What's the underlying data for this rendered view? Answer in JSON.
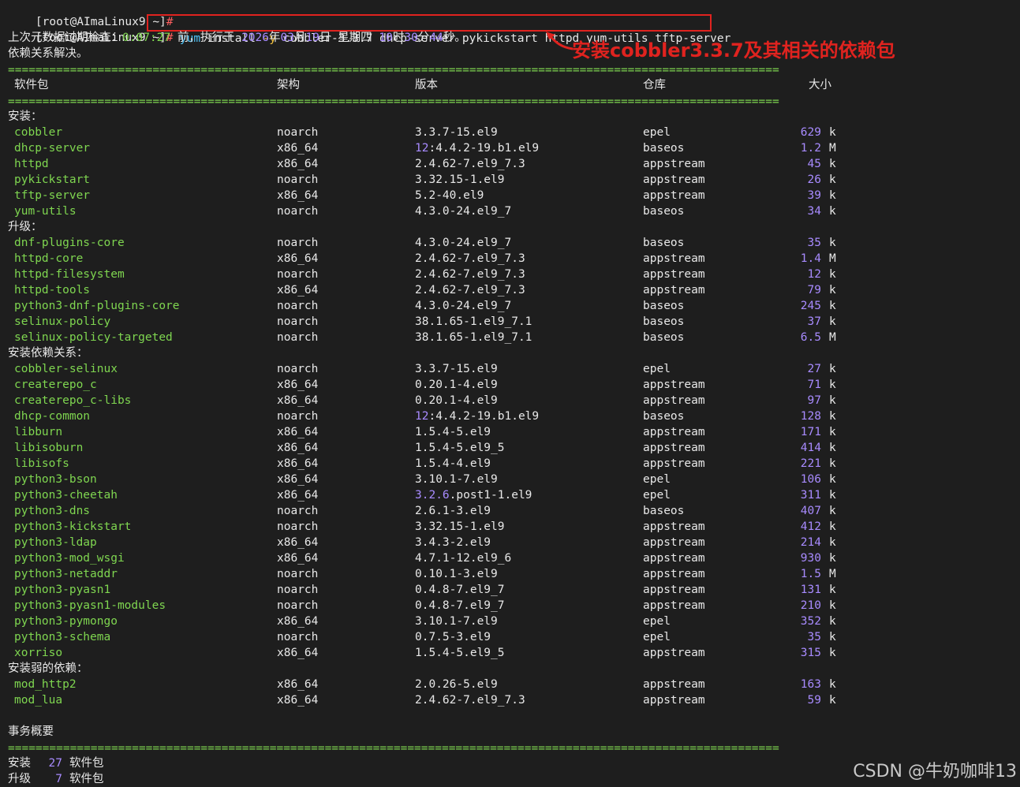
{
  "prompt1": "[root@AImaLinux9 ~]",
  "prompt2": "[root@AImaLinux9 ~]",
  "prompt_caret": "#",
  "command": {
    "yum": "yum",
    "sub": " install ",
    "flag": "-y",
    "rest": " cobbler-3.3.7 dhcp-server pykickstart httpd yum-utils tftp-server"
  },
  "meta_check": {
    "prefix": "上次元数据过期检查：",
    "time": "0:07:27",
    "mid": " 前，执行于 ",
    "year": "2026",
    "y_suffix": "年",
    "month": "03",
    "m_suffix": "月",
    "day": "19",
    "d_suffix": "日 星期四 ",
    "hour": "10",
    "h_suffix": "时",
    "minute": "30",
    "min_suffix": "分",
    "second": "44",
    "s_suffix": "秒。"
  },
  "resolving": "依赖关系解决。",
  "separator": "================================================================================================================",
  "headers": {
    "package": "软件包",
    "arch": "架构",
    "version": "版本",
    "repo": "仓库",
    "size": "大小"
  },
  "annotation": "安装cobbler3.3.7及其相关的依赖包",
  "sections": [
    {
      "title": "安装：",
      "rows": [
        {
          "name": "cobbler",
          "arch": "noarch",
          "ver_pre": "3.3.7-15.el9",
          "ver_epoch": "",
          "repo": "epel",
          "size": "629",
          "unit": "k"
        },
        {
          "name": "dhcp-server",
          "arch": "x86_64",
          "ver_epoch": "12",
          "ver_pre": ":4.4.2-19.b1.el9",
          "repo": "baseos",
          "size": "1.2",
          "unit": "M"
        },
        {
          "name": "httpd",
          "arch": "x86_64",
          "ver_pre": "2.4.62-7.el9_7.3",
          "ver_epoch": "",
          "repo": "appstream",
          "size": "45",
          "unit": "k"
        },
        {
          "name": "pykickstart",
          "arch": "noarch",
          "ver_pre": "3.32.15-1.el9",
          "ver_epoch": "",
          "repo": "appstream",
          "size": "26",
          "unit": "k"
        },
        {
          "name": "tftp-server",
          "arch": "x86_64",
          "ver_pre": "5.2-40.el9",
          "ver_epoch": "",
          "repo": "appstream",
          "size": "39",
          "unit": "k"
        },
        {
          "name": "yum-utils",
          "arch": "noarch",
          "ver_pre": "4.3.0-24.el9_7",
          "ver_epoch": "",
          "repo": "baseos",
          "size": "34",
          "unit": "k"
        }
      ]
    },
    {
      "title": "升级：",
      "rows": [
        {
          "name": "dnf-plugins-core",
          "arch": "noarch",
          "ver_pre": "4.3.0-24.el9_7",
          "ver_epoch": "",
          "repo": "baseos",
          "size": "35",
          "unit": "k"
        },
        {
          "name": "httpd-core",
          "arch": "x86_64",
          "ver_pre": "2.4.62-7.el9_7.3",
          "ver_epoch": "",
          "repo": "appstream",
          "size": "1.4",
          "unit": "M"
        },
        {
          "name": "httpd-filesystem",
          "arch": "noarch",
          "ver_pre": "2.4.62-7.el9_7.3",
          "ver_epoch": "",
          "repo": "appstream",
          "size": "12",
          "unit": "k"
        },
        {
          "name": "httpd-tools",
          "arch": "x86_64",
          "ver_pre": "2.4.62-7.el9_7.3",
          "ver_epoch": "",
          "repo": "appstream",
          "size": "79",
          "unit": "k"
        },
        {
          "name": "python3-dnf-plugins-core",
          "arch": "noarch",
          "ver_pre": "4.3.0-24.el9_7",
          "ver_epoch": "",
          "repo": "baseos",
          "size": "245",
          "unit": "k"
        },
        {
          "name": "selinux-policy",
          "arch": "noarch",
          "ver_pre": "38.1.65-1.el9_7.1",
          "ver_epoch": "",
          "repo": "baseos",
          "size": "37",
          "unit": "k"
        },
        {
          "name": "selinux-policy-targeted",
          "arch": "noarch",
          "ver_pre": "38.1.65-1.el9_7.1",
          "ver_epoch": "",
          "repo": "baseos",
          "size": "6.5",
          "unit": "M"
        }
      ]
    },
    {
      "title": "安装依赖关系：",
      "rows": [
        {
          "name": "cobbler-selinux",
          "arch": "noarch",
          "ver_pre": "3.3.7-15.el9",
          "ver_epoch": "",
          "repo": "epel",
          "size": "27",
          "unit": "k"
        },
        {
          "name": "createrepo_c",
          "arch": "x86_64",
          "ver_pre": "0.20.1-4.el9",
          "ver_epoch": "",
          "repo": "appstream",
          "size": "71",
          "unit": "k"
        },
        {
          "name": "createrepo_c-libs",
          "arch": "x86_64",
          "ver_pre": "0.20.1-4.el9",
          "ver_epoch": "",
          "repo": "appstream",
          "size": "97",
          "unit": "k"
        },
        {
          "name": "dhcp-common",
          "arch": "noarch",
          "ver_epoch": "12",
          "ver_pre": ":4.4.2-19.b1.el9",
          "repo": "baseos",
          "size": "128",
          "unit": "k"
        },
        {
          "name": "libburn",
          "arch": "x86_64",
          "ver_pre": "1.5.4-5.el9",
          "ver_epoch": "",
          "repo": "appstream",
          "size": "171",
          "unit": "k"
        },
        {
          "name": "libisoburn",
          "arch": "x86_64",
          "ver_pre": "1.5.4-5.el9_5",
          "ver_epoch": "",
          "repo": "appstream",
          "size": "414",
          "unit": "k"
        },
        {
          "name": "libisofs",
          "arch": "x86_64",
          "ver_pre": "1.5.4-4.el9",
          "ver_epoch": "",
          "repo": "appstream",
          "size": "221",
          "unit": "k"
        },
        {
          "name": "python3-bson",
          "arch": "x86_64",
          "ver_pre": "3.10.1-7.el9",
          "ver_epoch": "",
          "repo": "epel",
          "size": "106",
          "unit": "k"
        },
        {
          "name": "python3-cheetah",
          "arch": "x86_64",
          "ver_epoch": "3.2.6",
          "ver_pre": ".post1-1.el9",
          "repo": "epel",
          "size": "311",
          "unit": "k"
        },
        {
          "name": "python3-dns",
          "arch": "noarch",
          "ver_pre": "2.6.1-3.el9",
          "ver_epoch": "",
          "repo": "baseos",
          "size": "407",
          "unit": "k"
        },
        {
          "name": "python3-kickstart",
          "arch": "noarch",
          "ver_pre": "3.32.15-1.el9",
          "ver_epoch": "",
          "repo": "appstream",
          "size": "412",
          "unit": "k"
        },
        {
          "name": "python3-ldap",
          "arch": "x86_64",
          "ver_pre": "3.4.3-2.el9",
          "ver_epoch": "",
          "repo": "appstream",
          "size": "214",
          "unit": "k"
        },
        {
          "name": "python3-mod_wsgi",
          "arch": "x86_64",
          "ver_pre": "4.7.1-12.el9_6",
          "ver_epoch": "",
          "repo": "appstream",
          "size": "930",
          "unit": "k"
        },
        {
          "name": "python3-netaddr",
          "arch": "noarch",
          "ver_pre": "0.10.1-3.el9",
          "ver_epoch": "",
          "repo": "appstream",
          "size": "1.5",
          "unit": "M"
        },
        {
          "name": "python3-pyasn1",
          "arch": "noarch",
          "ver_pre": "0.4.8-7.el9_7",
          "ver_epoch": "",
          "repo": "appstream",
          "size": "131",
          "unit": "k"
        },
        {
          "name": "python3-pyasn1-modules",
          "arch": "noarch",
          "ver_pre": "0.4.8-7.el9_7",
          "ver_epoch": "",
          "repo": "appstream",
          "size": "210",
          "unit": "k"
        },
        {
          "name": "python3-pymongo",
          "arch": "x86_64",
          "ver_pre": "3.10.1-7.el9",
          "ver_epoch": "",
          "repo": "epel",
          "size": "352",
          "unit": "k"
        },
        {
          "name": "python3-schema",
          "arch": "noarch",
          "ver_pre": "0.7.5-3.el9",
          "ver_epoch": "",
          "repo": "epel",
          "size": "35",
          "unit": "k"
        },
        {
          "name": "xorriso",
          "arch": "x86_64",
          "ver_pre": "1.5.4-5.el9_5",
          "ver_epoch": "",
          "repo": "appstream",
          "size": "315",
          "unit": "k"
        }
      ]
    },
    {
      "title": "安装弱的依赖：",
      "rows": [
        {
          "name": "mod_http2",
          "arch": "x86_64",
          "ver_pre": "2.0.26-5.el9",
          "ver_epoch": "",
          "repo": "appstream",
          "size": "163",
          "unit": "k"
        },
        {
          "name": "mod_lua",
          "arch": "x86_64",
          "ver_pre": "2.4.62-7.el9_7.3",
          "ver_epoch": "",
          "repo": "appstream",
          "size": "59",
          "unit": "k"
        }
      ]
    }
  ],
  "summary_title": "事务概要",
  "summary": [
    {
      "label": "安装",
      "count": "27",
      "unit": "软件包"
    },
    {
      "label": "升级",
      "count": "7",
      "unit": "软件包"
    }
  ],
  "watermark": "CSDN @牛奶咖啡13"
}
